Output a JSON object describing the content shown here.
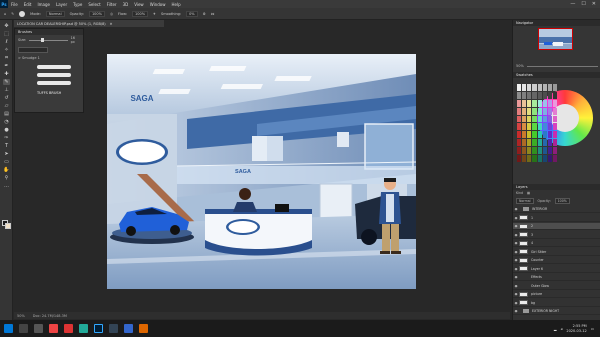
{
  "menubar": {
    "logo": "Ps",
    "items": [
      "File",
      "Edit",
      "Image",
      "Layer",
      "Type",
      "Select",
      "Filter",
      "3D",
      "View",
      "Window",
      "Help"
    ],
    "controls": [
      "—",
      "☐",
      "✕"
    ]
  },
  "options": {
    "mode_label": "Mode:",
    "mode_value": "Normal",
    "opacity_label": "Opacity:",
    "opacity_value": "100%",
    "flow_label": "Flow:",
    "flow_value": "100%",
    "smoothing_label": "Smoothing:",
    "smoothing_value": "0%"
  },
  "document": {
    "tab_title": "LOCATION CAR DEALERSHIP.psd @ 50% (1, RGB/8)",
    "close": "✕"
  },
  "brushes_panel": {
    "title": "Brushes",
    "size_label": "Size:",
    "size_value": "16 px",
    "group_label": "> Smudge 1",
    "preset_label": "TUFFS BRUSH"
  },
  "status": {
    "zoom": "50%",
    "doc_size": "Doc: 24.7M/148.3M"
  },
  "navigator": {
    "title": "Navigator",
    "zoom": "50%"
  },
  "swatches": {
    "title": "Swatches"
  },
  "layers": {
    "title": "Layers",
    "kind_label": "Kind",
    "blend_mode": "Normal",
    "opacity_label": "Opacity:",
    "opacity_value": "100%",
    "rows": [
      {
        "name": "INTERIOR",
        "type": "folder",
        "selected": false
      },
      {
        "name": "1",
        "type": "layer",
        "selected": false
      },
      {
        "name": "2",
        "type": "layer",
        "selected": true
      },
      {
        "name": "3",
        "type": "layer",
        "selected": false
      },
      {
        "name": "4",
        "type": "layer",
        "selected": false
      },
      {
        "name": "Girl Sitter",
        "type": "layer",
        "selected": false
      },
      {
        "name": "Counter",
        "type": "layer",
        "selected": false
      },
      {
        "name": "Layer 6",
        "type": "layer",
        "selected": false
      },
      {
        "name": "Effects",
        "type": "effect",
        "selected": false
      },
      {
        "name": "Outer Glow",
        "type": "effect",
        "selected": false
      },
      {
        "name": "picture",
        "type": "layer",
        "selected": false
      },
      {
        "name": "bg",
        "type": "layer",
        "selected": false
      },
      {
        "name": "EXTERIOR NIGHT",
        "type": "folder",
        "selected": false
      }
    ]
  },
  "artwork": {
    "sign_text": "SAGA",
    "counter_text": "SAGA"
  },
  "taskbar": {
    "time": "2:55 PM",
    "date": "2020-03-12"
  }
}
